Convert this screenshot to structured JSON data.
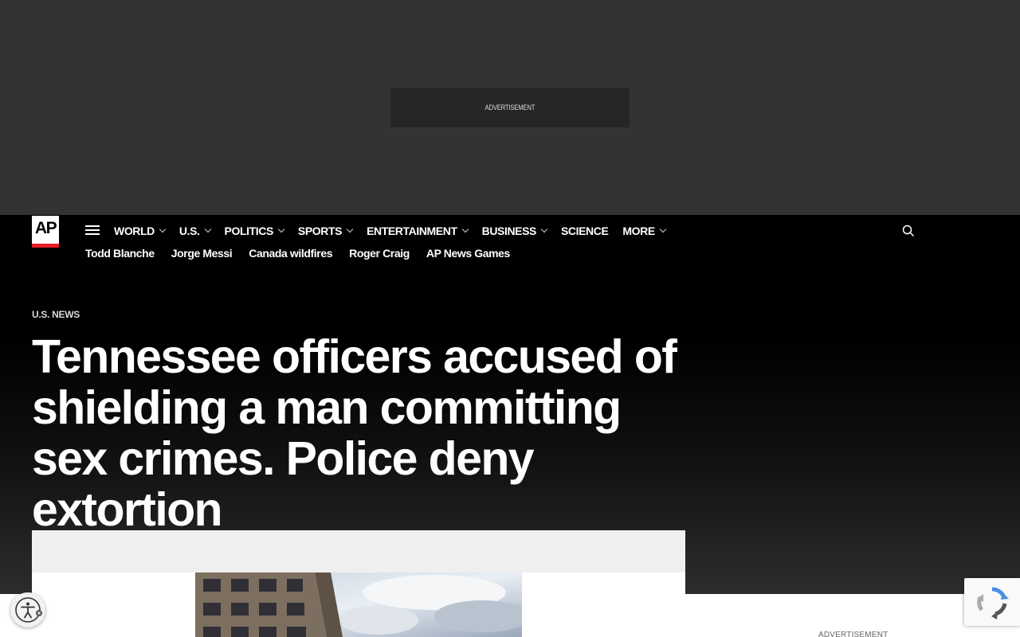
{
  "ad_top": {
    "label": "ADVERTISEMENT"
  },
  "header": {
    "logo_text": "AP",
    "nav": [
      {
        "label": "WORLD",
        "has_dropdown": true
      },
      {
        "label": "U.S.",
        "has_dropdown": true
      },
      {
        "label": "POLITICS",
        "has_dropdown": true
      },
      {
        "label": "SPORTS",
        "has_dropdown": true
      },
      {
        "label": "ENTERTAINMENT",
        "has_dropdown": true
      },
      {
        "label": "BUSINESS",
        "has_dropdown": true
      },
      {
        "label": "SCIENCE",
        "has_dropdown": false
      },
      {
        "label": "MORE",
        "has_dropdown": true
      }
    ],
    "trending": [
      "Todd Blanche",
      "Jorge Messi",
      "Canada wildfires",
      "Roger Craig",
      "AP News Games"
    ]
  },
  "article": {
    "section": "U.S. NEWS",
    "headline": "Tennessee officers accused of shielding a man committing sex crimes. Police deny extortion"
  },
  "ad_side": {
    "label": "ADVERTISEMENT"
  },
  "colors": {
    "accent_red": "#e31e26",
    "header_bg": "#000000",
    "ad_bg": "#333333"
  },
  "icons": [
    "menu-icon",
    "chevron-down-icon",
    "search-icon",
    "accessibility-icon",
    "recaptcha-icon"
  ]
}
